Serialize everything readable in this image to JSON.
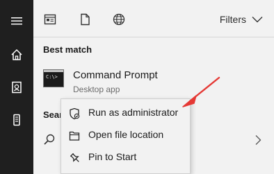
{
  "rail": {
    "items": [
      {
        "icon": "hamburger-menu-icon"
      },
      {
        "icon": "home-icon"
      },
      {
        "icon": "documents-icon"
      },
      {
        "icon": "device-icon"
      }
    ]
  },
  "topbar": {
    "scopes": [
      {
        "icon": "apps-scope-icon"
      },
      {
        "icon": "documents-scope-icon"
      },
      {
        "icon": "web-scope-icon"
      }
    ],
    "filters_label": "Filters"
  },
  "best_match": {
    "section_title": "Best match",
    "app_name": "Command Prompt",
    "app_type": "Desktop app",
    "icon_text": "C:\\>"
  },
  "search_section": {
    "title_visible": "Sear"
  },
  "context_menu": {
    "items": [
      {
        "label": "Run as administrator",
        "icon": "shield-icon"
      },
      {
        "label": "Open file location",
        "icon": "folder-location-icon"
      },
      {
        "label": "Pin to Start",
        "icon": "pin-icon"
      }
    ]
  },
  "colors": {
    "rail_bg": "#1f1f1f",
    "panel_bg": "#f2f2f2",
    "annotation_arrow": "#e53935"
  }
}
